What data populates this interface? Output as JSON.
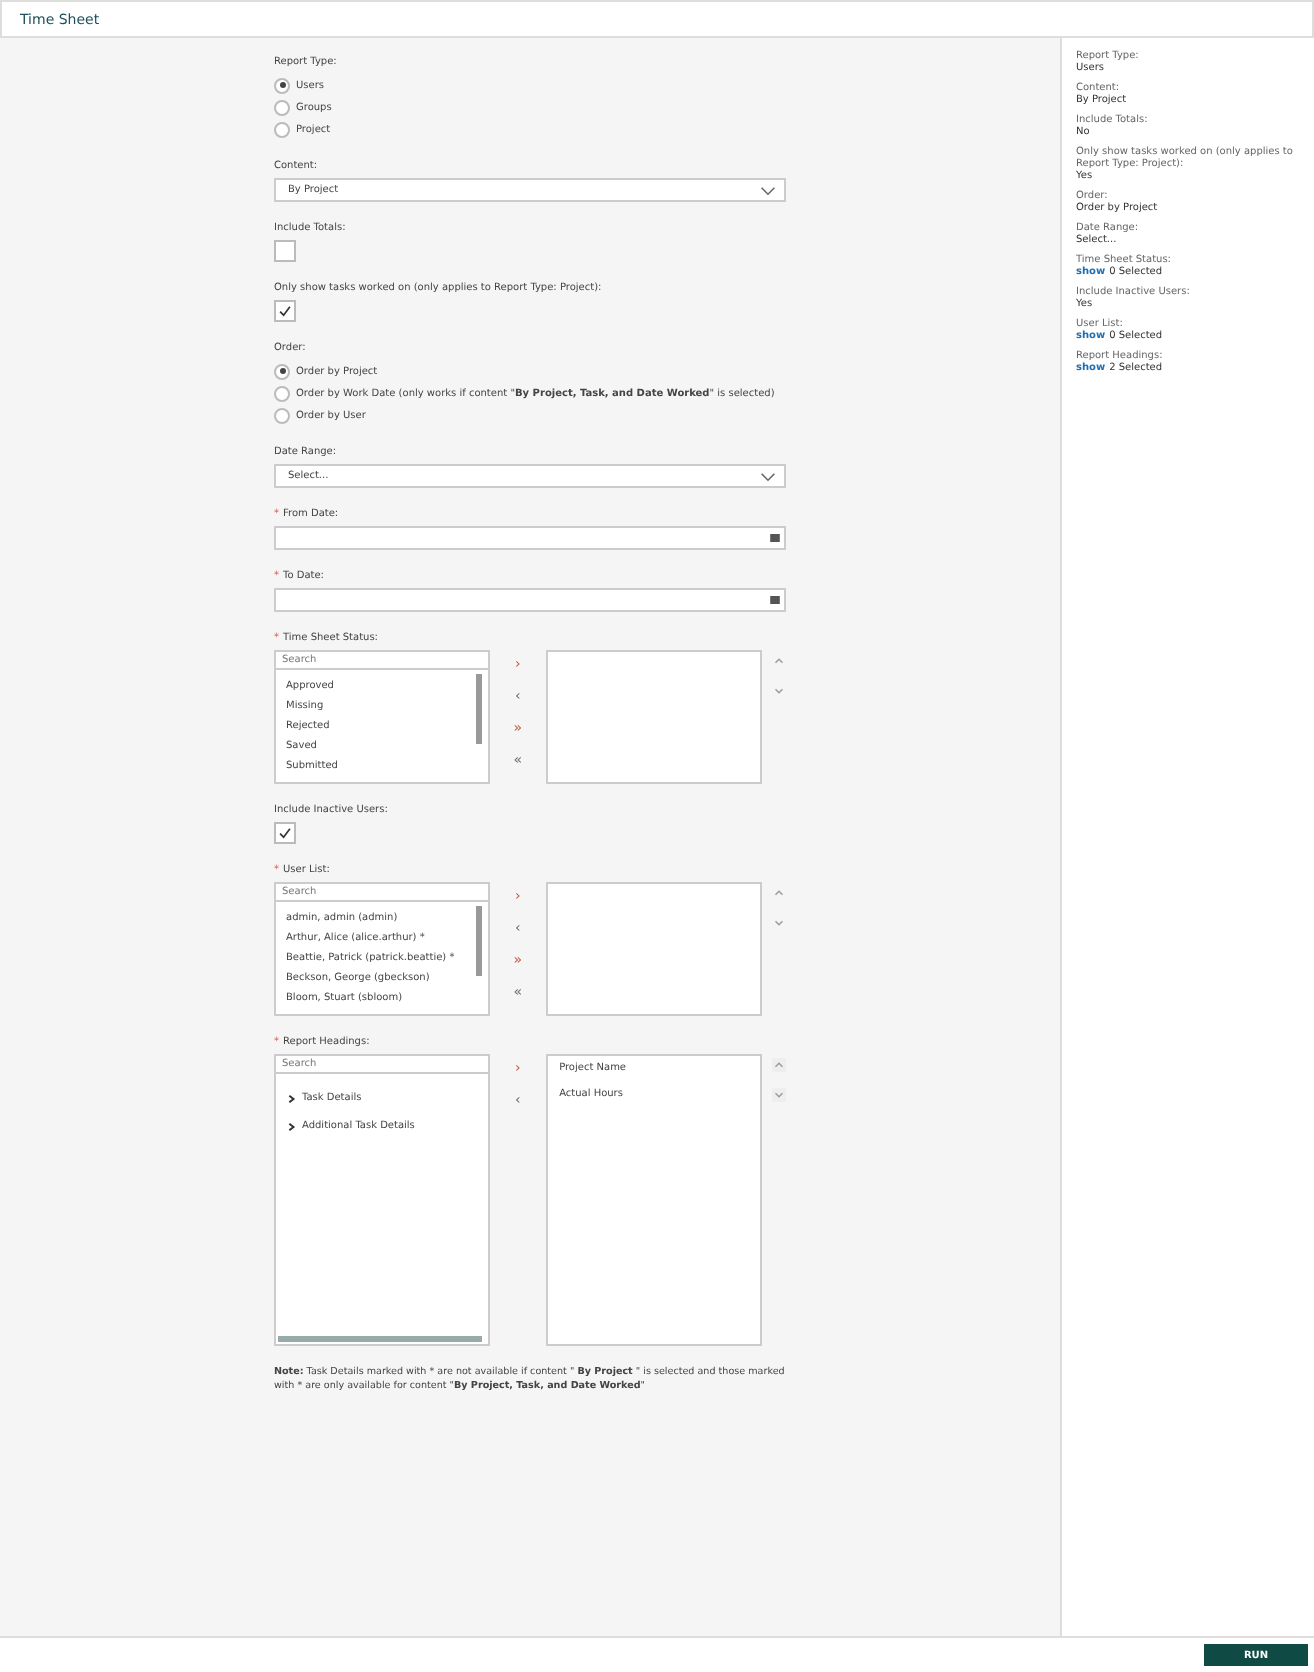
{
  "window": {
    "title": "Time Sheet"
  },
  "form": [
    {
      "kind": "radio",
      "label": "Report Type:",
      "options": [
        {
          "label": "Users",
          "selected": true
        },
        {
          "label": "Groups",
          "selected": false
        },
        {
          "label": "Project",
          "selected": false
        }
      ]
    },
    {
      "kind": "select",
      "label": "Content:",
      "value": "By Project"
    },
    {
      "kind": "checkbox",
      "label": "Include Totals:",
      "checked": false
    },
    {
      "kind": "checkbox",
      "label": "Only show tasks worked on (only applies to Report Type: Project):",
      "checked": true
    },
    {
      "kind": "radio",
      "label": "Order:",
      "options": [
        {
          "label": "Order by Project",
          "selected": true
        },
        {
          "label": "Order by Work Date (only works if content \"**By Project, Task, and Date Worked**\" is selected)",
          "selected": false
        },
        {
          "label": "Order by User",
          "selected": false
        }
      ]
    },
    {
      "kind": "select",
      "label": "Date Range:",
      "value": "Select..."
    },
    {
      "kind": "date",
      "label": "From Date:",
      "required_mark": "*"
    },
    {
      "kind": "date",
      "label": "To Date:",
      "required_mark": "*"
    },
    {
      "kind": "duallist",
      "label": "Time Sheet Status:",
      "required_mark": "*",
      "search_placeholder": "Search",
      "available": [
        "Approved",
        "Missing",
        "Rejected",
        "Saved",
        "Submitted"
      ],
      "move_buttons": [
        "›",
        "‹",
        "»",
        "«"
      ]
    },
    {
      "kind": "checkbox",
      "label": "Include Inactive Users:",
      "checked": true
    },
    {
      "kind": "duallist",
      "label": "User List:",
      "required_mark": "*",
      "search_placeholder": "Search",
      "available": [
        "admin, admin (admin)",
        "Arthur, Alice (alice.arthur) *",
        "Beattie, Patrick (patrick.beattie) *",
        "Beckson, George (gbeckson)",
        "Bloom, Stuart (sbloom)"
      ],
      "move_buttons": [
        "›",
        "‹",
        "»",
        "«"
      ]
    },
    {
      "kind": "treelist",
      "label": "Report Headings:",
      "required_mark": "*",
      "search_placeholder": "Search",
      "available": [
        {
          "label": "Task Details",
          "expanded": false
        },
        {
          "label": "Additional Task Details",
          "expanded": false
        }
      ],
      "move_buttons": [
        "›",
        "‹"
      ],
      "selected_items": [
        "Project Name",
        "Actual Hours"
      ]
    }
  ],
  "note": "**Note:** Task Details marked with * are not available if content \" **By Project** \" is selected and those marked with * are only available for content \"**By Project, Task, and Date Worked**\"",
  "summary": [
    {
      "label": "Report Type:",
      "value": "Users"
    },
    {
      "label": "Content:",
      "value": "By Project"
    },
    {
      "label": "Include Totals:",
      "value": "No"
    },
    {
      "label": "Only show tasks worked on (only applies to Report Type: Project):",
      "value": "Yes"
    },
    {
      "label": "Order:",
      "value": "Order by Project"
    },
    {
      "label": "Date Range:",
      "value": "Select..."
    },
    {
      "label": "Time Sheet Status:",
      "link": "show",
      "value": "0 Selected"
    },
    {
      "label": "Include Inactive Users:",
      "value": "Yes"
    },
    {
      "label": "User List:",
      "link": "show",
      "value": "0 Selected"
    },
    {
      "label": "Report Headings:",
      "link": "show",
      "value": "2 Selected"
    }
  ],
  "footer": {
    "run_button": "RUN"
  }
}
